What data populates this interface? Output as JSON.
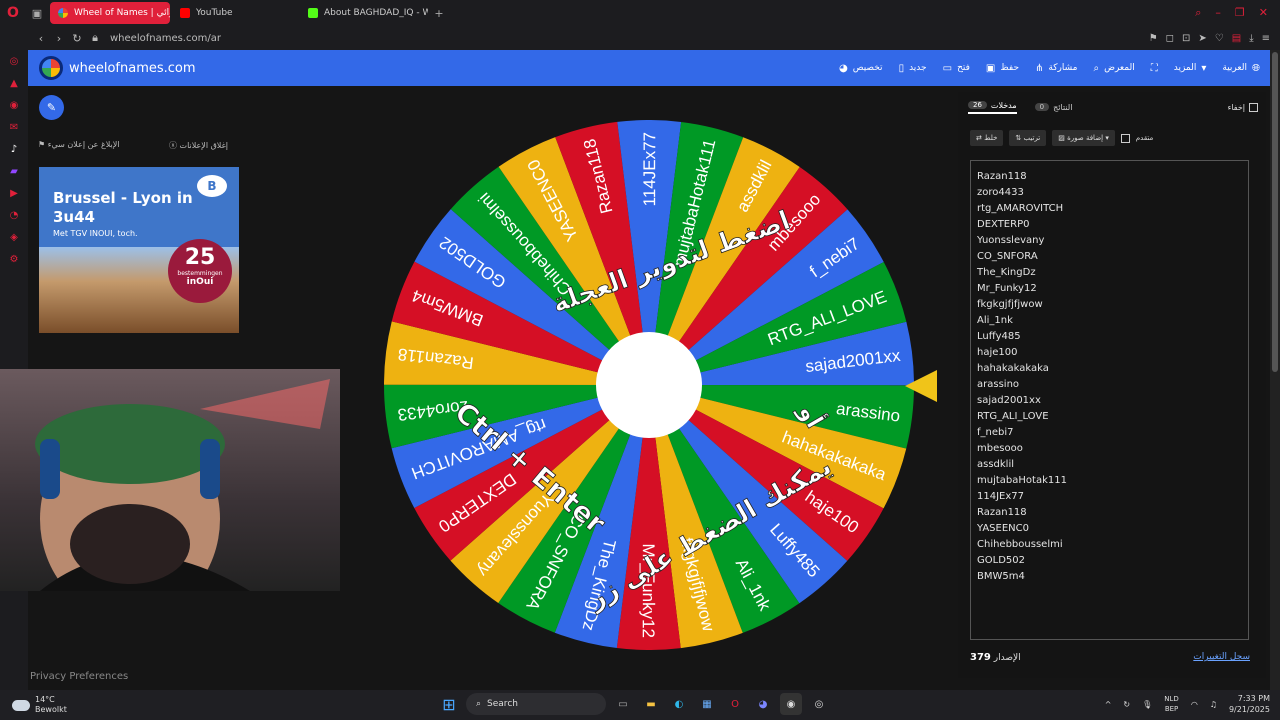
{
  "tabs": [
    {
      "label": "Wheel of Names | عشوائي",
      "color": "#3369e8"
    },
    {
      "label": "YouTube",
      "color": "#ff0000"
    },
    {
      "label": "About BAGHDAD_IQ - Wa",
      "color": "#53fc18"
    }
  ],
  "url": "wheelofnames.com/ar",
  "brand": "wheelofnames.com",
  "menu": [
    "تخصيص",
    "جديد",
    "فتح",
    "حفظ",
    "مشاركة",
    "المعرض",
    "المزيد",
    "العربية"
  ],
  "ad_links": {
    "report": "الإبلاغ عن إعلان سيء",
    "close": "إغلاق الإعلانات"
  },
  "ad": {
    "title": "Brussel - Lyon in 3u44",
    "subtitle": "Met TGV INOUI, toch.",
    "badge_num": "25",
    "badge_text": "bestemmingen",
    "badge_brand": "inOui",
    "logo": "B"
  },
  "privacy": "Privacy Preferences",
  "wheel_overlay": {
    "line1": "اضغط لتدوير العجلة",
    "line2": "أو",
    "line3": "يمكنك الضغط على زر",
    "line4": "Ctrl + Enter"
  },
  "panel": {
    "tab_entries": "مدخلات",
    "entries_count": "26",
    "tab_results": "النتائج",
    "results_count": "0",
    "hide": "إخفاء",
    "shuffle": "خلط",
    "sort": "ترتيب",
    "add_image": "إضافة صورة",
    "advanced": "متقدم",
    "version_label": "الإصدار",
    "version": "379",
    "changelog": "سجل التغييرات"
  },
  "entries": [
    "Razan118",
    "zoro4433",
    "rtg_AMAROVITCH",
    "DEXTERP0",
    "Yuonsslevany",
    "CO_SNFORA",
    "The_KingDz",
    "Mr_Funky12",
    "fkgkgjfjfjwow",
    "Ali_1nk",
    "Luffy485",
    "haje100",
    "hahakakakaka",
    "arassino",
    "sajad2001xx",
    "RTG_ALI_LOVE",
    "f_nebi7",
    "mbesooo",
    "assdklil",
    "mujtabaHotak111",
    "114JEx77",
    "Razan118",
    "YASEENC0",
    "Chihebbousselmi",
    "GOLD502",
    "BMW5m4"
  ],
  "wheel_colors": [
    "#eeb211",
    "#d50f25",
    "#3369e8",
    "#009925"
  ],
  "taskbar": {
    "temp": "14°C",
    "weather": "Bewolkt",
    "search": "Search",
    "lang1": "NLD",
    "lang2": "BEP",
    "time": "7:33 PM",
    "date": "9/21/2025"
  }
}
